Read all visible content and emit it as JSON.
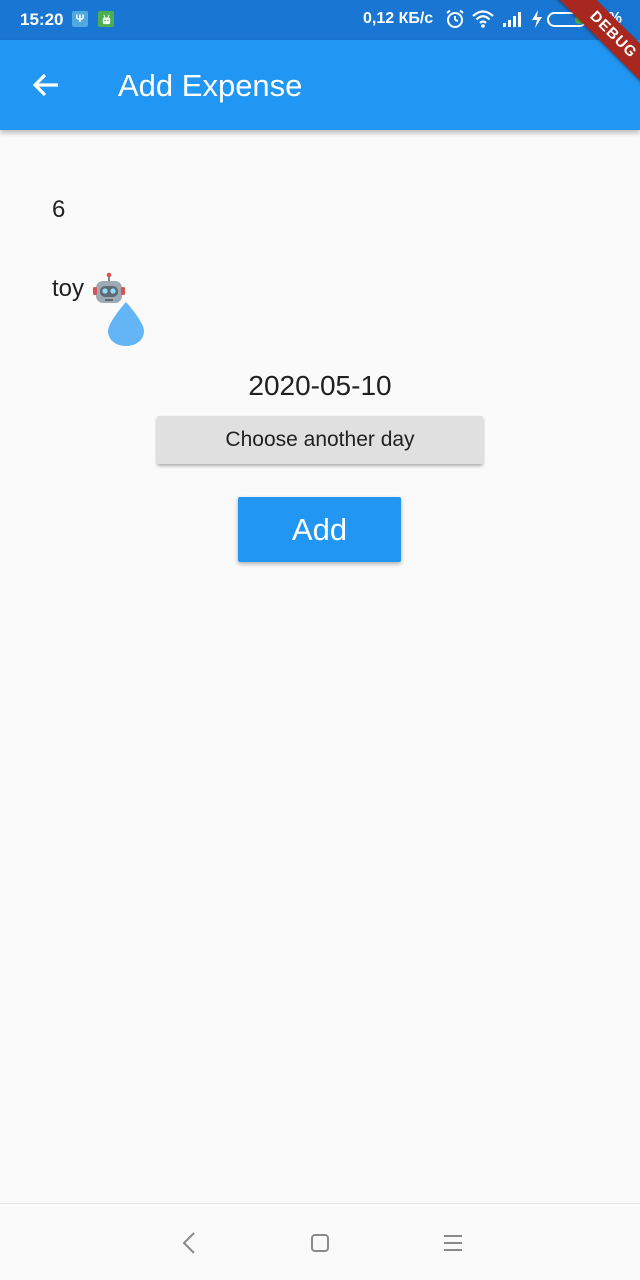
{
  "status_bar": {
    "time": "15:20",
    "notification_icons": [
      "usb-icon",
      "android-icon"
    ],
    "network_speed": "0,12 КБ/с",
    "icons": [
      "alarm-icon",
      "wifi-icon",
      "signal-icon",
      "charging-icon"
    ],
    "battery_level": "29%",
    "debug_banner": "DEBUG"
  },
  "app_bar": {
    "title": "Add Expense",
    "back_icon": "arrow-back-icon"
  },
  "form": {
    "amount": "6",
    "description": "toy",
    "description_emoji": "robot-icon",
    "drop_icon": "water-drop-icon",
    "date": "2020-05-10",
    "choose_day_label": "Choose another day",
    "add_label": "Add"
  },
  "nav_bar": {
    "icons": [
      "back-nav-icon",
      "home-nav-icon",
      "menu-nav-icon"
    ]
  },
  "colors": {
    "status_bar": "#1976d2",
    "primary": "#2196f3",
    "background": "#fafafa",
    "secondary_button": "#e0e0e0",
    "debug": "#a8271f"
  }
}
